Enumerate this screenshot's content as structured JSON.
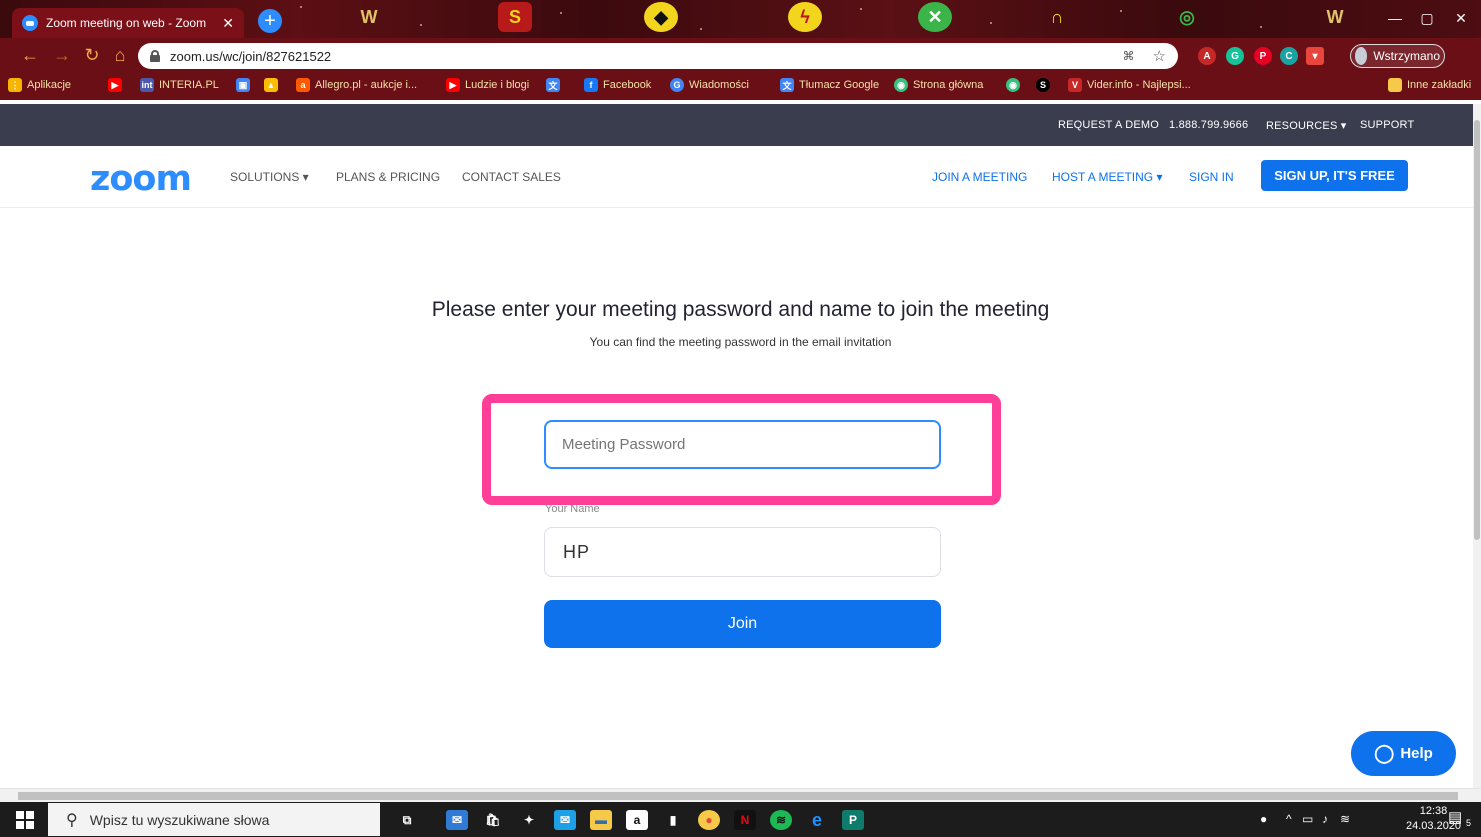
{
  "browser": {
    "tab_title": "Zoom meeting on web - Zoom",
    "tab_close": "✕",
    "new_tab": "+",
    "url": "zoom.us/wc/join/827621522",
    "profile_label": "Wstrzymano",
    "window_controls": [
      "—",
      "▢",
      "✕"
    ],
    "bookmarks": [
      {
        "label": "Aplikacje",
        "color": "#f7b500"
      },
      {
        "label": "",
        "color": "#ff0000"
      },
      {
        "label": "INTERIA.PL",
        "color": "#4b59a8"
      },
      {
        "label": "",
        "color": "#4285f4"
      },
      {
        "label": "",
        "color": "#fbbc04"
      },
      {
        "label": "Allegro.pl - aukcje i...",
        "color": "#ff5a00"
      },
      {
        "label": "Ludzie i blogi",
        "color": "#ff0000"
      },
      {
        "label": "",
        "color": "#4285f4"
      },
      {
        "label": "Facebook",
        "color": "#1877f2"
      },
      {
        "label": "Wiadomości",
        "color": "#4285f4"
      },
      {
        "label": "Tłumacz Google",
        "color": "#4285f4"
      },
      {
        "label": "Strona główna",
        "color": "#39c07f"
      },
      {
        "label": "",
        "color": "#39c07f"
      },
      {
        "label": "",
        "color": "#000000"
      },
      {
        "label": "Vider.info - Najlepsi...",
        "color": "#c62828"
      },
      {
        "label": "Inne zakładki",
        "color": "#f7c948"
      }
    ]
  },
  "zoom_topbar": {
    "request_demo": "REQUEST A DEMO",
    "phone": "1.888.799.9666",
    "resources": "RESOURCES ▾",
    "support": "SUPPORT"
  },
  "header": {
    "logo": "zoom",
    "solutions": "SOLUTIONS ▾",
    "plans": "PLANS & PRICING",
    "contact": "CONTACT SALES",
    "join": "JOIN A MEETING",
    "host": "HOST A MEETING ▾",
    "signin": "SIGN IN",
    "signup": "SIGN UP, IT'S FREE"
  },
  "form": {
    "title": "Please enter your meeting password and name to join the meeting",
    "subtitle": "You can find the meeting password in the email invitation",
    "password_placeholder": "Meeting Password",
    "password_value": "",
    "name_label": "Your Name",
    "name_value": "HP",
    "join_label": "Join",
    "highlight_color": "#ff3e98"
  },
  "help": {
    "label": "Help"
  },
  "taskbar": {
    "search_placeholder": "Wpisz tu wyszukiwane słowa",
    "time": "12:38",
    "date": "24.03.2020",
    "notification_count": "5",
    "apps": [
      {
        "name": "task-view-icon",
        "glyph": "⧉",
        "color": "#1c1c1c"
      },
      {
        "name": "mail-app-icon",
        "glyph": "✉",
        "color": "#2f7bd6"
      },
      {
        "name": "store-icon",
        "glyph": "🛍",
        "color": "#1c1c1c"
      },
      {
        "name": "dropbox-icon",
        "glyph": "✦",
        "color": "#1c1c1c"
      },
      {
        "name": "mail-icon",
        "glyph": "✉",
        "color": "#1ea0e6"
      },
      {
        "name": "file-explorer-icon",
        "glyph": "▬",
        "color": "#f7c948"
      },
      {
        "name": "amazon-icon",
        "glyph": "a",
        "color": "#ffffff"
      },
      {
        "name": "file-icon",
        "glyph": "▮",
        "color": "#ffffff"
      },
      {
        "name": "chrome-icon",
        "glyph": "●",
        "color": "#e8453c"
      },
      {
        "name": "netflix-icon",
        "glyph": "N",
        "color": "#111111"
      },
      {
        "name": "spotify-icon",
        "glyph": "≋",
        "color": "#1db954"
      },
      {
        "name": "edge-icon",
        "glyph": "e",
        "color": "#1c1c1c"
      },
      {
        "name": "publisher-icon",
        "glyph": "P",
        "color": "#0f7b6c"
      }
    ]
  }
}
